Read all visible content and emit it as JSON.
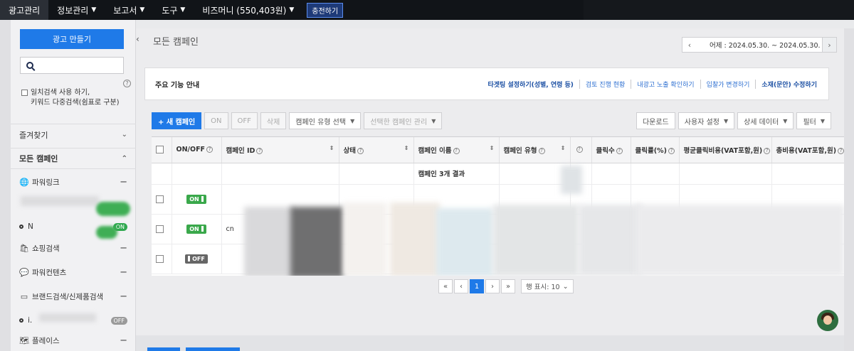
{
  "topnav": {
    "items": [
      {
        "label": "광고관리",
        "has_menu": false
      },
      {
        "label": "정보관리",
        "has_menu": true
      },
      {
        "label": "보고서",
        "has_menu": true
      },
      {
        "label": "도구",
        "has_menu": true
      },
      {
        "label": "비즈머니 (550,403원)",
        "has_menu": true
      }
    ],
    "charge_label": "충전하기"
  },
  "sidebar": {
    "create_label": "광고 만들기",
    "search_placeholder": "",
    "exact_match_label_1": "일치검색 사용 하기,",
    "exact_match_label_2": "키워드 다중검색(쉼표로 구분)",
    "favorites_label": "즐겨찾기",
    "all_campaigns_label": "모든 캠페인",
    "items": [
      {
        "label": "파워링크"
      },
      {
        "label": "쇼핑검색"
      },
      {
        "label": "파워컨텐츠"
      },
      {
        "label": "브랜드검색/신제품검색"
      },
      {
        "label": "플레이스"
      }
    ],
    "sub_on_1": "ON",
    "sub_on_2": "ON",
    "sub_off": "OFF",
    "sub_n_label": "N",
    "sub_i_label": "i."
  },
  "main": {
    "title": "모든 캠페인",
    "date_range": "어제 : 2024.05.30. ~ 2024.05.30.",
    "notice": {
      "label": "주요 기능 안내",
      "links": [
        "타겟팅 설정하기(성별, 연령 등)",
        "검토 진행 현황",
        "내광고 노출 확인하기",
        "입찰가 변경하기",
        "소재(문안) 수정하기"
      ]
    },
    "toolbar": {
      "new_campaign": "+ 새 캠페인",
      "on": "ON",
      "off": "OFF",
      "delete": "삭제",
      "type_select": "캠페인 유형 선택",
      "manage_selected": "선택한 캠페인 관리",
      "download": "다운로드",
      "user_settings": "사용자 설정",
      "detail_data": "상세 데이터",
      "filter": "필터"
    },
    "table": {
      "headers": [
        "ON/OFF",
        "캠페인 ID",
        "상태",
        "캠페인 이름",
        "캠페인 유형",
        "",
        "클릭수",
        "클릭률(%)",
        "평균클릭비용(VAT포함,원)",
        "총비용(VAT포함,원)"
      ],
      "summary": "캠페인 3개 결과",
      "rows": [
        {
          "toggle": "ON",
          "id": ""
        },
        {
          "toggle": "ON",
          "id": "cn"
        },
        {
          "toggle": "OFF",
          "id": ""
        }
      ]
    },
    "pager": {
      "first": "«",
      "prev": "‹",
      "current": "1",
      "next": "›",
      "last": "»",
      "per_page": "행 표시: 10"
    }
  }
}
